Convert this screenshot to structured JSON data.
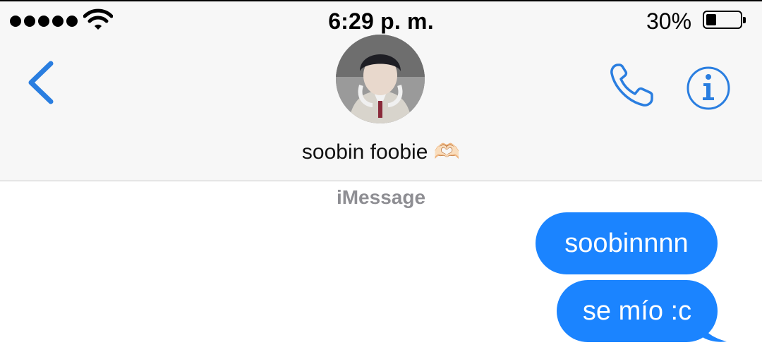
{
  "status_bar": {
    "time": "6:29 p. m.",
    "battery_percent": "30%",
    "battery_level": 0.3,
    "signal_bars": 5,
    "icons": [
      "signal-dots-icon",
      "wifi-icon",
      "battery-icon"
    ]
  },
  "nav": {
    "back_icon": "chevron-left-icon",
    "contact_name": "soobin foobie 🫶🏻",
    "call_icon": "phone-icon",
    "info_icon": "info-icon"
  },
  "conversation": {
    "service_label": "iMessage",
    "messages": [
      {
        "direction": "outgoing",
        "text": "soobinnnn"
      },
      {
        "direction": "outgoing",
        "text": "se mío :c"
      }
    ]
  },
  "colors": {
    "accent": "#1b84ff",
    "icon_blue": "#2a7ee0",
    "header_bg": "#f7f7f7",
    "service_gray": "#8e8e93"
  }
}
